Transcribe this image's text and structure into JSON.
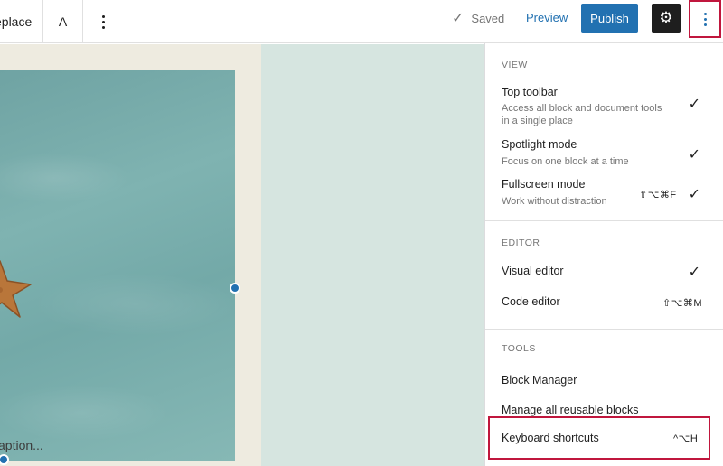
{
  "toolbar": {
    "replace_label": "eplace",
    "text_label": "A",
    "saved_label": "Saved",
    "preview_label": "Preview",
    "publish_label": "Publish"
  },
  "canvas": {
    "caption_placeholder": "aption..."
  },
  "menu": {
    "view": {
      "label": "VIEW",
      "items": [
        {
          "title": "Top toolbar",
          "desc": "Access all block and document tools in a single place",
          "checked": true,
          "shortcut": ""
        },
        {
          "title": "Spotlight mode",
          "desc": "Focus on one block at a time",
          "checked": true,
          "shortcut": ""
        },
        {
          "title": "Fullscreen mode",
          "desc": "Work without distraction",
          "checked": true,
          "shortcut": "⇧⌥⌘F"
        }
      ]
    },
    "editor": {
      "label": "EDITOR",
      "items": [
        {
          "title": "Visual editor",
          "checked": true,
          "shortcut": ""
        },
        {
          "title": "Code editor",
          "checked": false,
          "shortcut": "⇧⌥⌘M"
        }
      ]
    },
    "tools": {
      "label": "TOOLS",
      "items": [
        {
          "title": "Block Manager",
          "shortcut": ""
        },
        {
          "title": "Manage all reusable blocks",
          "shortcut": ""
        },
        {
          "title": "Keyboard shortcuts",
          "shortcut": "^⌥H"
        }
      ]
    }
  },
  "colors": {
    "accent": "#2271b1",
    "highlight": "#c0163d",
    "canvas_bg": "#d6e5e0"
  }
}
